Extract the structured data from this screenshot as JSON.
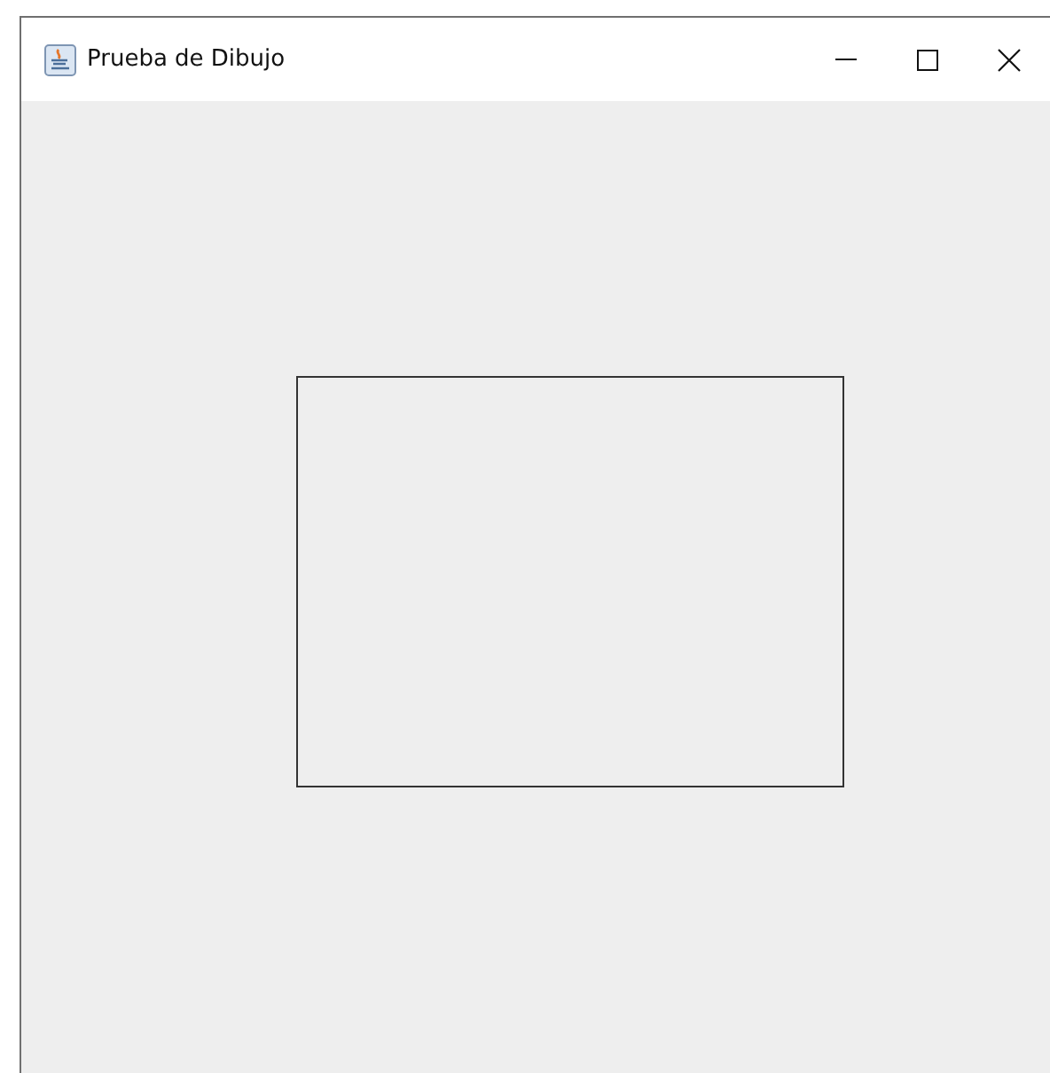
{
  "window": {
    "title": "Prueba de Dibujo"
  },
  "canvas": {
    "shapes": [
      {
        "kind": "rectangle"
      }
    ]
  }
}
